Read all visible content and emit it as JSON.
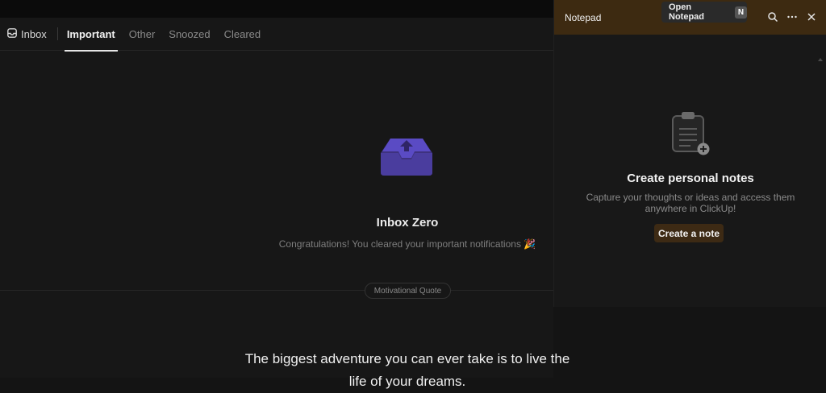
{
  "tabs": {
    "inbox_label": "Inbox",
    "items": [
      {
        "label": "Important",
        "active": true
      },
      {
        "label": "Other",
        "active": false
      },
      {
        "label": "Snoozed",
        "active": false
      },
      {
        "label": "Cleared",
        "active": false
      }
    ]
  },
  "empty_state": {
    "icon": "inbox-tray-icon",
    "title": "Inbox Zero",
    "subtitle": "Congratulations! You cleared your important notifications 🎉"
  },
  "quote": {
    "pill_label": "Motivational Quote",
    "text": "The biggest adventure you can ever take is to live the life of your dreams."
  },
  "notepad": {
    "title": "Notepad",
    "tooltip_label": "Open Notepad",
    "tooltip_shortcut": "N",
    "heading": "Create personal notes",
    "description": "Capture your thoughts or ideas and access them anywhere in ClickUp!",
    "button_label": "Create a note",
    "icons": [
      "search-icon",
      "more-icon",
      "close-icon",
      "clipboard-add-icon"
    ]
  },
  "colors": {
    "background": "#171717",
    "notepad_header": "#3d2a11",
    "accent_purple": "#4a3d9e",
    "button_brown": "#3d2a14"
  }
}
